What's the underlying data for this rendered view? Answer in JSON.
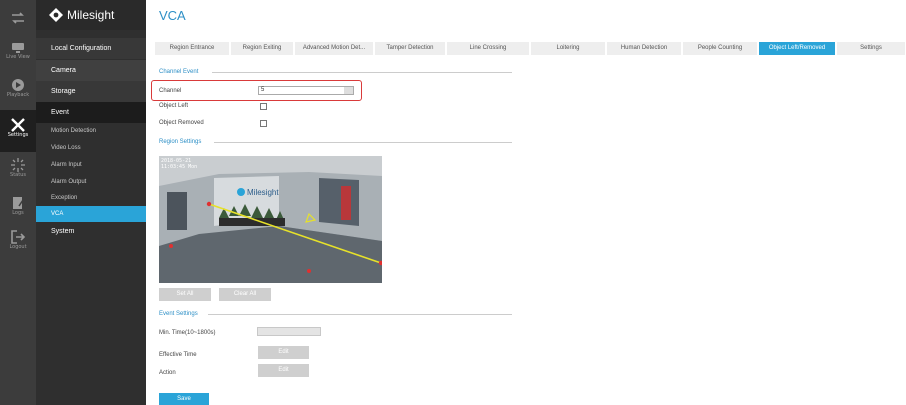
{
  "rail": {
    "items": [
      {
        "label": "",
        "icon": "swap-arrows-icon"
      },
      {
        "label": "Live View",
        "icon": "live-view-icon"
      },
      {
        "label": "Playback",
        "icon": "playback-icon"
      },
      {
        "label": "Settings",
        "icon": "settings-tools-icon"
      },
      {
        "label": "Status",
        "icon": "status-spinner-icon"
      },
      {
        "label": "Logs",
        "icon": "logs-icon"
      },
      {
        "label": "Logout",
        "icon": "logout-icon"
      }
    ]
  },
  "brand": {
    "name": "Milesight"
  },
  "menu": {
    "local_configuration": "Local Configuration",
    "camera": "Camera",
    "storage": "Storage",
    "event": "Event",
    "subitems": [
      "Motion Detection",
      "Video Loss",
      "Alarm Input",
      "Alarm Output",
      "Exception",
      "VCA"
    ],
    "system": "System"
  },
  "page": {
    "title": "VCA"
  },
  "tabs": [
    "Region Entrance",
    "Region Exiting",
    "Advanced Motion Det...",
    "Tamper Detection",
    "Line Crossing",
    "Loitering",
    "Human Detection",
    "People Counting",
    "Object Left/Removed",
    "Settings"
  ],
  "active_tab": "Object Left/Removed",
  "channel_event": {
    "title": "Channel Event",
    "channel_label": "Channel",
    "channel_value": "5",
    "object_left_label": "Object Left",
    "object_removed_label": "Object Removed"
  },
  "region_settings": {
    "title": "Region Settings",
    "timestamp_line1": "2018-05-21",
    "timestamp_line2": "11:03:45 Mon",
    "overlay_brand": "Milesight",
    "set_all": "Set All",
    "clear_all": "Clear All"
  },
  "event_settings": {
    "title": "Event Settings",
    "min_time_label": "Min. Time(10~1800s)",
    "effective_time_label": "Effective Time",
    "action_label": "Action",
    "edit": "Edit"
  },
  "save": "Save",
  "colors": {
    "accent": "#2aa4d8",
    "highlight": "#d93a3a",
    "sidebar": "#2f2f2f"
  }
}
